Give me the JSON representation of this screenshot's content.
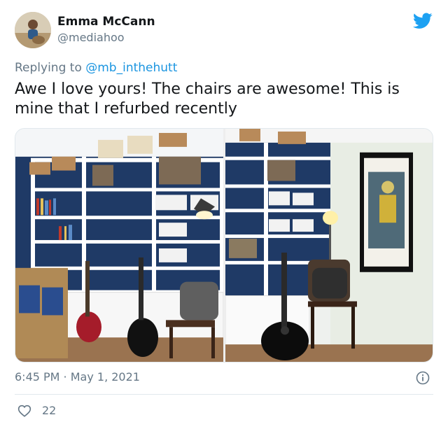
{
  "user": {
    "name": "Emma McCann",
    "handle": "@mediahoo"
  },
  "reply": {
    "prefix": "Replying to ",
    "mention": "@mb_inthehutt"
  },
  "tweet": {
    "text": "Awe I love yours! The chairs are awesome! This is mine that I refurbed recently"
  },
  "meta": {
    "time": "6:45 PM",
    "separator": " · ",
    "date": "May 1, 2021"
  },
  "stats": {
    "likes": "22"
  },
  "icons": {
    "brand": "twitter-bird-icon",
    "info": "info-icon",
    "like": "heart-icon"
  },
  "colors": {
    "twitter_blue": "#1da1f2",
    "link": "#1b95e0",
    "muted": "#657786"
  }
}
